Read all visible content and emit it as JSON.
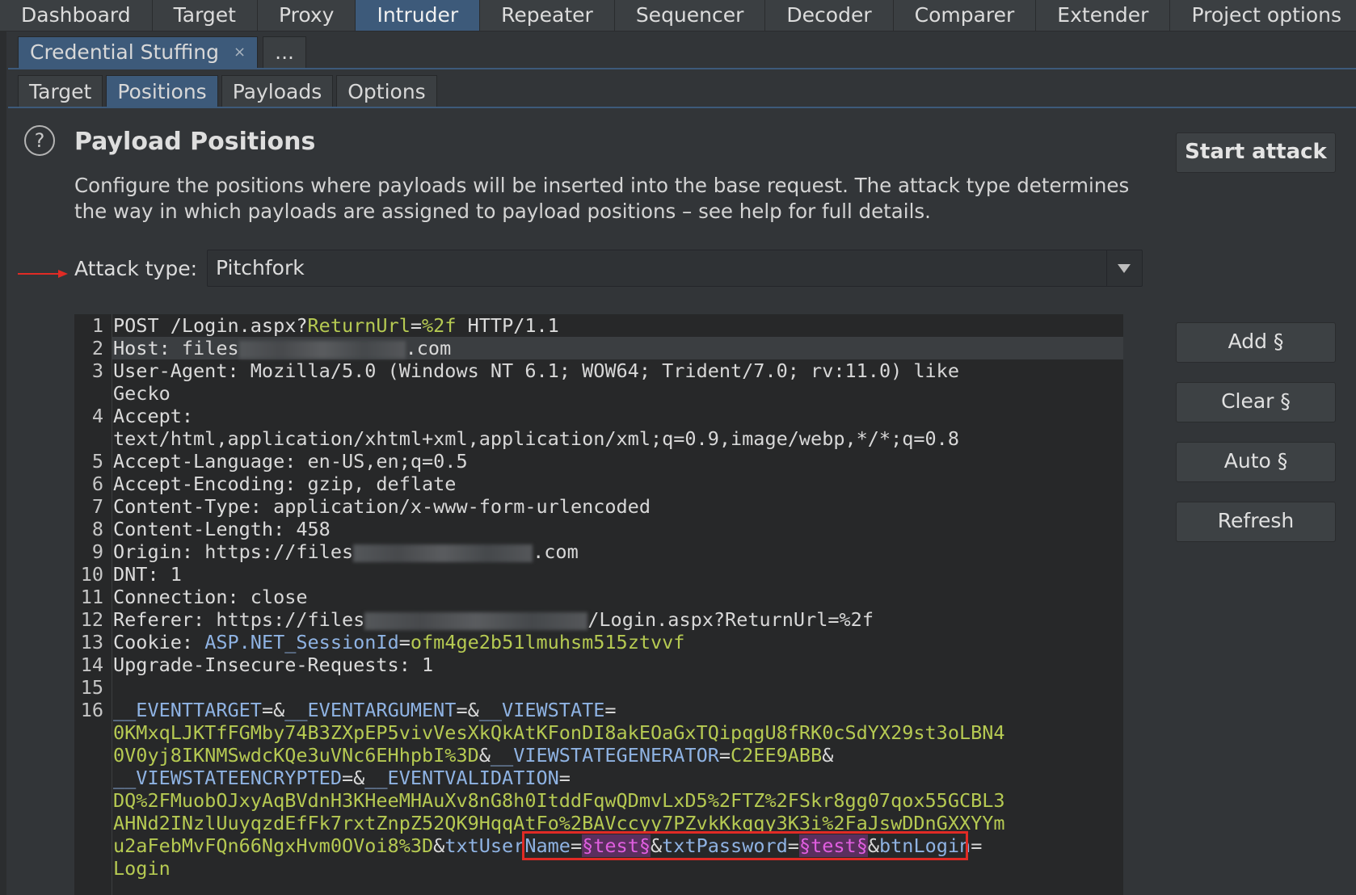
{
  "main_tabs": [
    "Dashboard",
    "Target",
    "Proxy",
    "Intruder",
    "Repeater",
    "Sequencer",
    "Decoder",
    "Comparer",
    "Extender",
    "Project options"
  ],
  "main_active": "Intruder",
  "attack_tabs": {
    "active": "Credential Stuffing",
    "close": "×",
    "more": "..."
  },
  "sub_tabs": [
    "Target",
    "Positions",
    "Payloads",
    "Options"
  ],
  "help_icon": "?",
  "title": "Payload Positions",
  "description_lines": [
    "Configure the positions where payloads will be inserted into the base request. The attack type determines",
    "the way in which payloads are assigned to payload positions – see help for full details."
  ],
  "attack_type": {
    "label": "Attack type:",
    "value": "Pitchfork"
  },
  "buttons": {
    "start": "Start attack",
    "add": "Add §",
    "clear": "Clear §",
    "auto": "Auto §",
    "refresh": "Refresh"
  },
  "line_numbers": [
    "1",
    "2",
    "3",
    "",
    "4",
    "",
    "5",
    "6",
    "7",
    "8",
    "9",
    "10",
    "11",
    "12",
    "13",
    "14",
    "15",
    "16"
  ],
  "req": {
    "l1": [
      "POST /Login.aspx?",
      "ReturnUrl",
      "=",
      "%2f",
      " HTTP/1.1"
    ],
    "l2": [
      "Host:",
      " files",
      ".com"
    ],
    "l3a": [
      "User-Agent:",
      " Mozilla/5.0 (Windows NT 6.1; WOW64; Trident/7.0; rv:11.0) like"
    ],
    "l3b": "Gecko",
    "l4a": "Accept:",
    "l4b": "text/html,application/xhtml+xml,application/xml;q=0.9,image/webp,*/*;q=0.8",
    "l5": [
      "Accept-Language:",
      " en-US,en;q=0.5"
    ],
    "l6": [
      "Accept-Encoding:",
      " gzip, deflate"
    ],
    "l7": [
      "Content-Type:",
      " application/x-www-form-urlencoded"
    ],
    "l8": [
      "Content-Length:",
      " 458"
    ],
    "l9": [
      "Origin:",
      " https://files",
      ".com"
    ],
    "l10": [
      "DNT:",
      " 1"
    ],
    "l11": [
      "Connection:",
      " close"
    ],
    "l12": [
      "Referer:",
      " https://files",
      "/Login.aspx?ReturnUrl=%2f"
    ],
    "l13": [
      "Cookie:",
      " ",
      "ASP.NET_SessionId",
      "=",
      "ofm4ge2b51lmuhsm515ztvvf"
    ],
    "l14": [
      "Upgrade-Insecure-Requests:",
      " 1"
    ],
    "b1": [
      "__EVENTTARGET",
      "=&",
      "__EVENTARGUMENT",
      "=&",
      "__VIEWSTATE",
      "="
    ],
    "b2": "0KMxqLJKTfFGMby74B3ZXpEP5vivVesXkQkAtKFonDI8akEOaGxTQipqgU8fRK0cSdYX29st3oLBN4",
    "b3": [
      "0V0yj8IKNMSwdcKQe3uVNc6EHhpbI%3D",
      "&",
      "__VIEWSTATEGENERATOR",
      "=",
      "C2EE9ABB",
      "&"
    ],
    "b4": [
      "__VIEWSTATEENCRYPTED",
      "=&",
      "__EVENTVALIDATION",
      "="
    ],
    "b5": "DQ%2FMuobOJxyAqBVdnH3KHeeMHAuXv8nG8h0ItddFqwQDmvLxD5%2FTZ%2FSkr8gg07qox55GCBL3",
    "b6": "AHNd2INzlUuyqzdEfFk7rxtZnpZ52QK9HqqAtFo%2BAVccyy7PZvkKkqqy3K3i%2FaJswDDnGXXYYm",
    "b7": [
      "u2aFebMvFQn66NgxHvm0OVoi8%3D",
      "&",
      "txt",
      "UserName",
      "=",
      "§test§",
      "&",
      "txtPassword",
      "=",
      "§test§",
      "&",
      "btnLogin",
      "="
    ],
    "b8": "Login"
  }
}
